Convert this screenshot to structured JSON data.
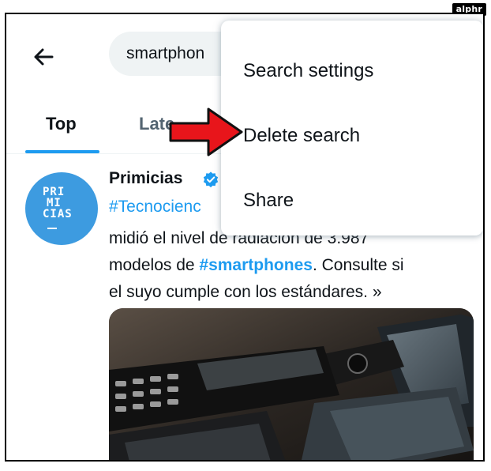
{
  "watermark": "alphr",
  "search": {
    "value": "smartphon"
  },
  "tabs": [
    {
      "label": "Top",
      "active": true
    },
    {
      "label": "Late",
      "active": false
    }
  ],
  "menu": {
    "items": [
      {
        "label": "Search settings"
      },
      {
        "label": "Delete search"
      },
      {
        "label": "Share"
      }
    ]
  },
  "tweet": {
    "avatar_text": [
      "PRI",
      "MI",
      "CIAS"
    ],
    "author": "Primicias",
    "hashtag_fragment": "#Tecnocienc",
    "line3": "midió el nivel de radiación de 3.987",
    "line4_pre": "modelos de ",
    "line4_hashtag": "#smartphones",
    "line4_post": ". Consulte si",
    "line5": "el suyo cumple con los estándares. »"
  },
  "colors": {
    "accent": "#1d9bf0",
    "text": "#0f1419",
    "muted": "#536471",
    "search_bg": "#eff3f4",
    "avatar_bg": "#3d9be0",
    "annotation_arrow": "#e8151b"
  },
  "icons": {
    "back": "arrow-left-icon",
    "verified": "verified-badge-icon",
    "annotation": "red-arrow-icon"
  }
}
